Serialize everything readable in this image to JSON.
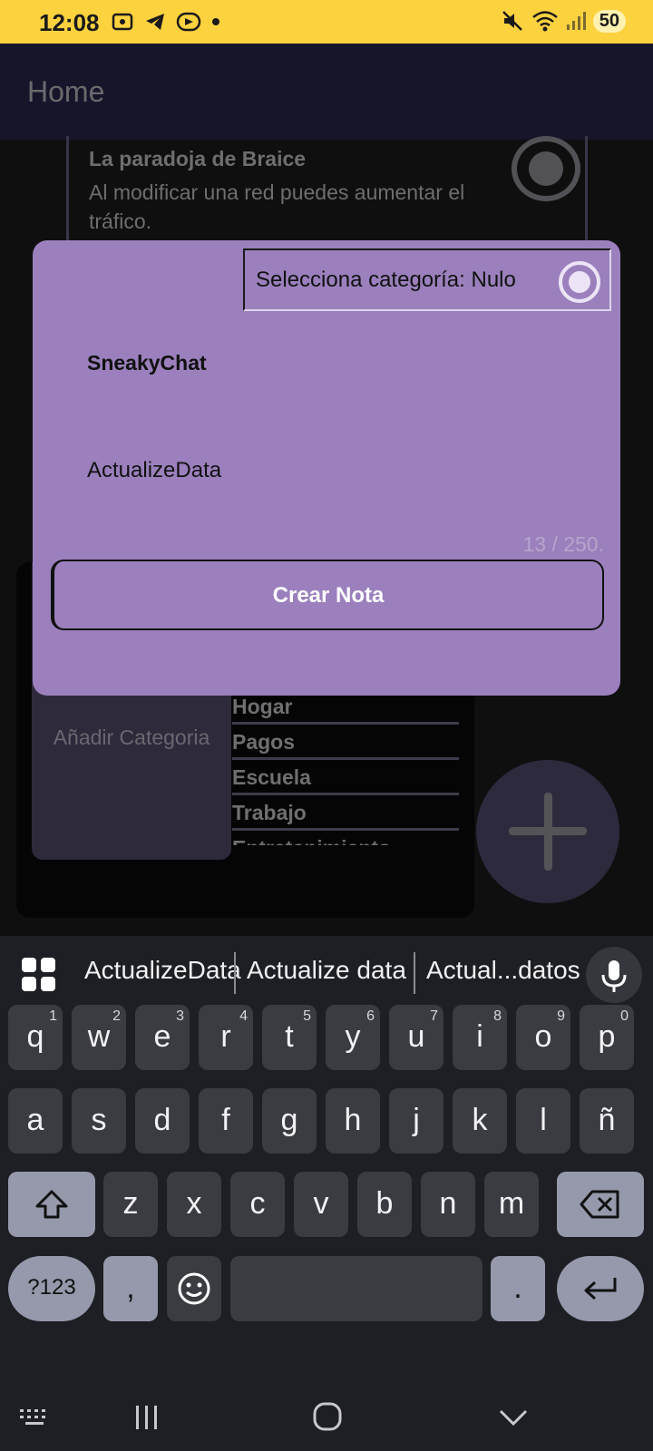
{
  "status_bar": {
    "time": "12:08",
    "battery": "50"
  },
  "app_bar": {
    "title": "Home"
  },
  "note": {
    "title": "La paradoja de Braice",
    "body": "Al modificar una red puedes aumentar el tráfico."
  },
  "categories": {
    "add_label": "Añadir Categoria",
    "items": [
      "Hogar",
      "Pagos",
      "Escuela",
      "Trabajo",
      "Entretenimiento"
    ]
  },
  "dialog": {
    "category_label": "Selecciona categoría: Nulo",
    "title": "SneakyChat",
    "body": "ActualizeData",
    "counter": "13 / 250.",
    "create_button": "Crear Nota"
  },
  "keyboard": {
    "suggestions": [
      "ActualizeData",
      "Actualize data",
      "Actual...datos"
    ],
    "row1": [
      "q",
      "w",
      "e",
      "r",
      "t",
      "y",
      "u",
      "i",
      "o",
      "p"
    ],
    "row1_hints": [
      "1",
      "2",
      "3",
      "4",
      "5",
      "6",
      "7",
      "8",
      "9",
      "0"
    ],
    "row2": [
      "a",
      "s",
      "d",
      "f",
      "g",
      "h",
      "j",
      "k",
      "l",
      "ñ"
    ],
    "row3": [
      "z",
      "x",
      "c",
      "v",
      "b",
      "n",
      "m"
    ],
    "symbols_key": "?123",
    "comma_key": ",",
    "period_key": "."
  }
}
